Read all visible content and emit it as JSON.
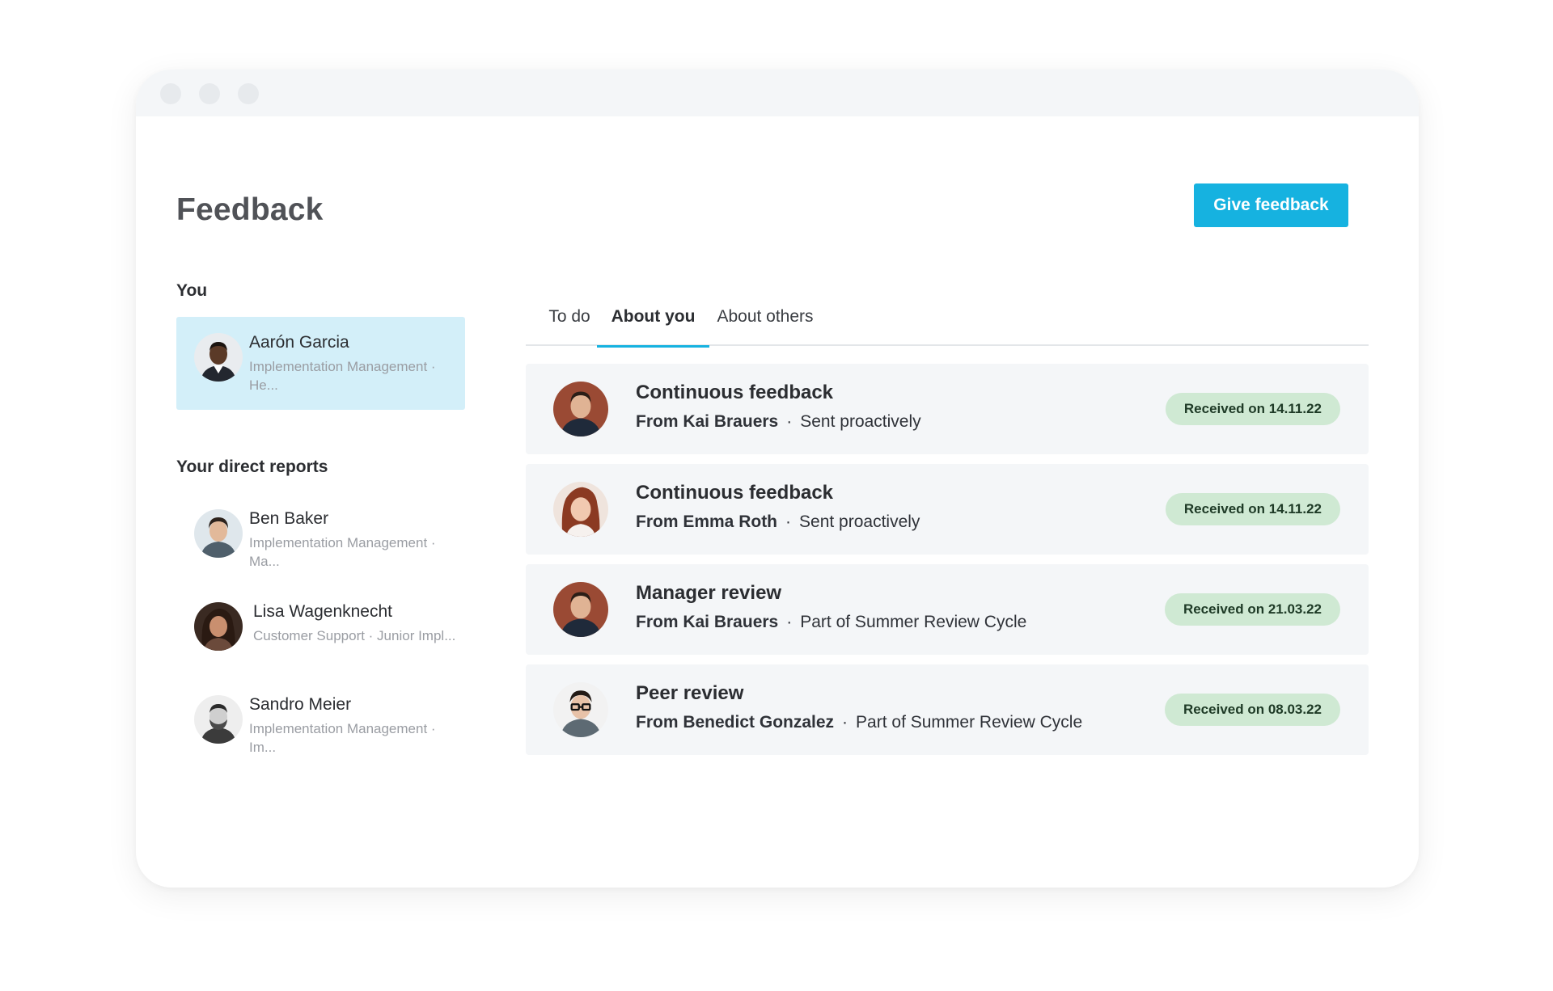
{
  "page": {
    "title": "Feedback",
    "give_feedback_label": "Give feedback"
  },
  "sidebar": {
    "you_label": "You",
    "you": {
      "name": "Aarón Garcia",
      "subtitle": "Implementation Management · He..."
    },
    "reports_label": "Your direct reports",
    "reports": [
      {
        "name": "Ben Baker",
        "subtitle": "Implementation Management · Ma..."
      },
      {
        "name": "Lisa Wagenknecht",
        "subtitle": "Customer Support · Junior Impl..."
      },
      {
        "name": "Sandro Meier",
        "subtitle": "Implementation Management · Im..."
      }
    ]
  },
  "tabs": [
    {
      "label": "To do",
      "active": false
    },
    {
      "label": "About you",
      "active": true
    },
    {
      "label": "About others",
      "active": false
    }
  ],
  "feedback_items": [
    {
      "title": "Continuous feedback",
      "from": "From Kai Brauers",
      "separator": "·",
      "context": "Sent proactively",
      "badge": "Received on 14.11.22"
    },
    {
      "title": "Continuous feedback",
      "from": "From Emma Roth",
      "separator": "·",
      "context": "Sent proactively",
      "badge": "Received on 14.11.22"
    },
    {
      "title": "Manager review",
      "from": "From Kai Brauers",
      "separator": "·",
      "context": "Part of Summer Review Cycle",
      "badge": "Received on 21.03.22"
    },
    {
      "title": "Peer review",
      "from": "From Benedict Gonzalez",
      "separator": "·",
      "context": "Part of Summer Review Cycle",
      "badge": "Received on 08.03.22"
    }
  ],
  "colors": {
    "accent": "#16b2e0",
    "selected_bg": "#d3eff9",
    "card_bg": "#f4f6f8",
    "badge_bg": "#cfe9d3"
  }
}
